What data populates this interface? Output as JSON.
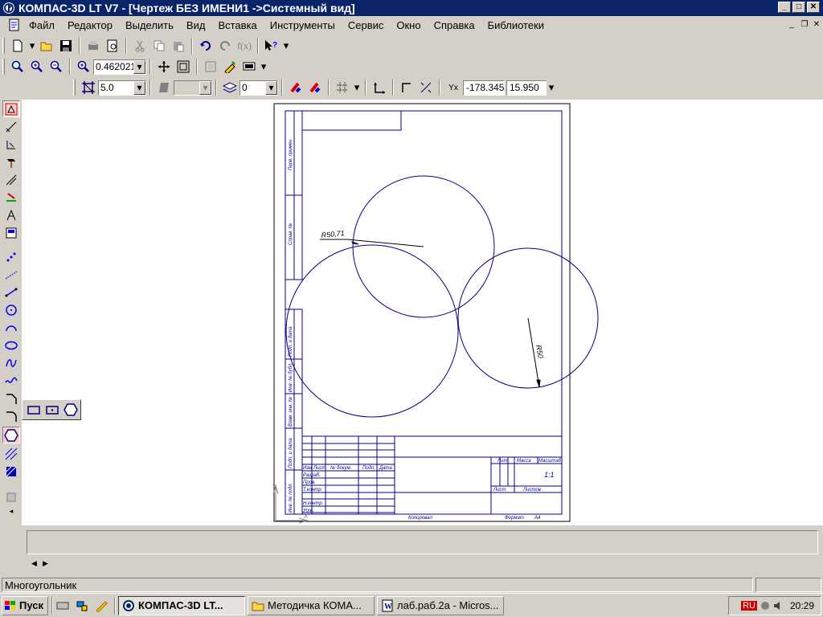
{
  "window": {
    "title": "КОМПАС-3D LT V7 - [Чертеж БЕЗ ИМЕНИ1 ->Системный вид]",
    "min": "_",
    "max": "□",
    "close": "✕"
  },
  "menu": [
    "Файл",
    "Редактор",
    "Выделить",
    "Вид",
    "Вставка",
    "Инструменты",
    "Сервис",
    "Окно",
    "Справка",
    "Библиотеки"
  ],
  "view_toolbar": {
    "zoom": "0.462021"
  },
  "current_params": {
    "step": "5.0",
    "layer": "0",
    "x": "-178.345",
    "y": "15.950"
  },
  "drawing": {
    "dim1": "R50,71",
    "dim2": "R50",
    "stamp": {
      "lit": "Лит",
      "mass": "Масса",
      "scale": "Масштаб",
      "scale_val": "1:1",
      "sheet": "Лист",
      "sheets": "Листов",
      "copied": "Копировал",
      "format": "Формат",
      "format_val": "A4",
      "izm": "Изм",
      "list": "Лист",
      "ndoc": "№ докум.",
      "sign": "Подп.",
      "date": "Дата",
      "razrab": "Разраб.",
      "prov": "Пров.",
      "tkontr": "Т.контр.",
      "nkontr": "Н.контр.",
      "utv": "Утв."
    },
    "side": [
      "Перв. примен.",
      "Справ. №",
      "Подп. и дата",
      "Инв. № дубл.",
      "Взам. инв. №",
      "Подп. и дата",
      "Инв. № подл."
    ]
  },
  "status": {
    "text": "Многоугольник"
  },
  "taskbar": {
    "start": "Пуск",
    "tasks": [
      "КОМПАС-3D LT...",
      "Методичка КОМА...",
      "лаб.раб.2а - Micros..."
    ],
    "lang": "RU",
    "time": "20:29"
  }
}
